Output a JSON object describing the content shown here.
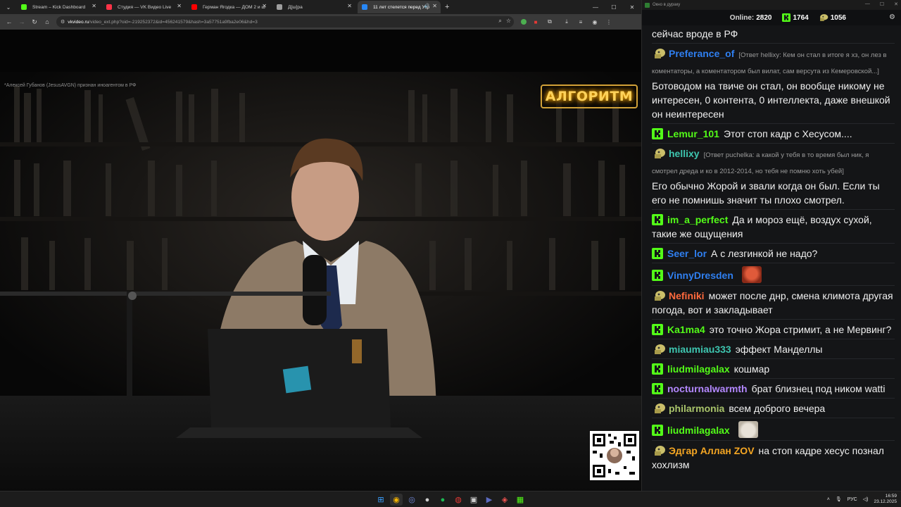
{
  "browser": {
    "tabs": [
      {
        "title": "Stream – Kick Dashboard",
        "color": "#53fc18",
        "active": false
      },
      {
        "title": "Студия — VK Видео Live",
        "color": "#ff3347",
        "active": false
      },
      {
        "title": "Герман Ягодка — ДОМ 2 и ш",
        "color": "#ff0000",
        "active": false
      },
      {
        "title": "Д[ш]ра",
        "color": "#9e9e9e",
        "active": false
      },
      {
        "title": "11 лет стелется перед Укр",
        "color": "#2787f5",
        "active": true
      }
    ],
    "url_domain": "vkvideo.ru",
    "url_path": "/video_ext.php?oid=-219252372&id=456241579&hash=3a57751a9fba2e06&hd=3"
  },
  "video": {
    "foreign_agent_note": "*Алексей Губанов (JesusAVGN) признан иноагентом в РФ",
    "logo_text": "АЛГОРИТМ"
  },
  "chat": {
    "window_title": "Окно в дураку",
    "online_label": "Online:",
    "online_count": "2820",
    "kick_count": "1764",
    "gold_count": "1056",
    "messages": [
      {
        "badge": "none",
        "user": "",
        "user_color": "#ffffff",
        "reply": "",
        "text": "сейчас вроде в РФ",
        "emote": ""
      },
      {
        "badge": "gold",
        "user": "Preferance_of",
        "user_color": "#2f7ff0",
        "reply": "[Ответ hellixy: Кем он стал в итоге я хз, он лез в коментаторы, а коментатором был вилат, сам версута из Кемеровской...]",
        "text": "Ботоводом на твиче он стал, он вообще никому не интересен, 0 контента, 0 интеллекта, даже внешкой он неинтересен",
        "emote": ""
      },
      {
        "badge": "kick",
        "user": "Lemur_101",
        "user_color": "#53fc18",
        "reply": "",
        "text": "Этот стоп кадр с Хесусом....",
        "emote": ""
      },
      {
        "badge": "gold",
        "user": "hellixy",
        "user_color": "#3ec6b0",
        "reply": "[Ответ puchelka: а какой у тебя в то время был ник, я смотрел дреда и ко в 2012-2014, но тебя не помню хоть убей]",
        "text": "Его обычно Жорой и звали когда он был. Если ты его не помнишь значит ты плохо смотрел.",
        "emote": ""
      },
      {
        "badge": "kick",
        "user": "im_a_perfect",
        "user_color": "#53fc18",
        "reply": "",
        "text": "Да и мороз ещё, воздух сухой, такие же ощущения",
        "emote": ""
      },
      {
        "badge": "kick",
        "user": "Seer_lor",
        "user_color": "#2f7ff0",
        "reply": "",
        "text": "А с лезгинкой не надо?",
        "emote": ""
      },
      {
        "badge": "kick",
        "user": "VinnyDresden",
        "user_color": "#2f7ff0",
        "reply": "",
        "text": "",
        "emote": "face"
      },
      {
        "badge": "gold",
        "user": "Nefiniki",
        "user_color": "#ff6a3d",
        "reply": "",
        "text": "может после днр, смена климота другая погода, вот и закладывает",
        "emote": ""
      },
      {
        "badge": "kick",
        "user": "Ka1ma4",
        "user_color": "#53fc18",
        "reply": "",
        "text": "это точно Жора стримит, а не Мервинг?",
        "emote": ""
      },
      {
        "badge": "gold",
        "user": "miaumiau333",
        "user_color": "#3ec6b0",
        "reply": "",
        "text": "эффект Манделлы",
        "emote": ""
      },
      {
        "badge": "kick",
        "user": "liudmilagalax",
        "user_color": "#53fc18",
        "reply": "",
        "text": "кошмар",
        "emote": ""
      },
      {
        "badge": "kick",
        "user": "nocturnalwarmth",
        "user_color": "#b388ff",
        "reply": "",
        "text": "брат близнец под ником watti",
        "emote": ""
      },
      {
        "badge": "gold",
        "user": "philarmonia",
        "user_color": "#a9c46b",
        "reply": "",
        "text": "всем доброго вечера",
        "emote": ""
      },
      {
        "badge": "kick",
        "user": "liudmilagalax",
        "user_color": "#53fc18",
        "reply": "",
        "text": "",
        "emote": "cat"
      },
      {
        "badge": "gold",
        "user": "Эдгар Аллан ZOV",
        "user_color": "#f5a623",
        "reply": "",
        "text": "на стоп кадре хесус познал хохлизм",
        "emote": ""
      }
    ]
  },
  "taskbar": {
    "lang": "РУС",
    "time": "16:59",
    "date": "23.12.2025"
  }
}
